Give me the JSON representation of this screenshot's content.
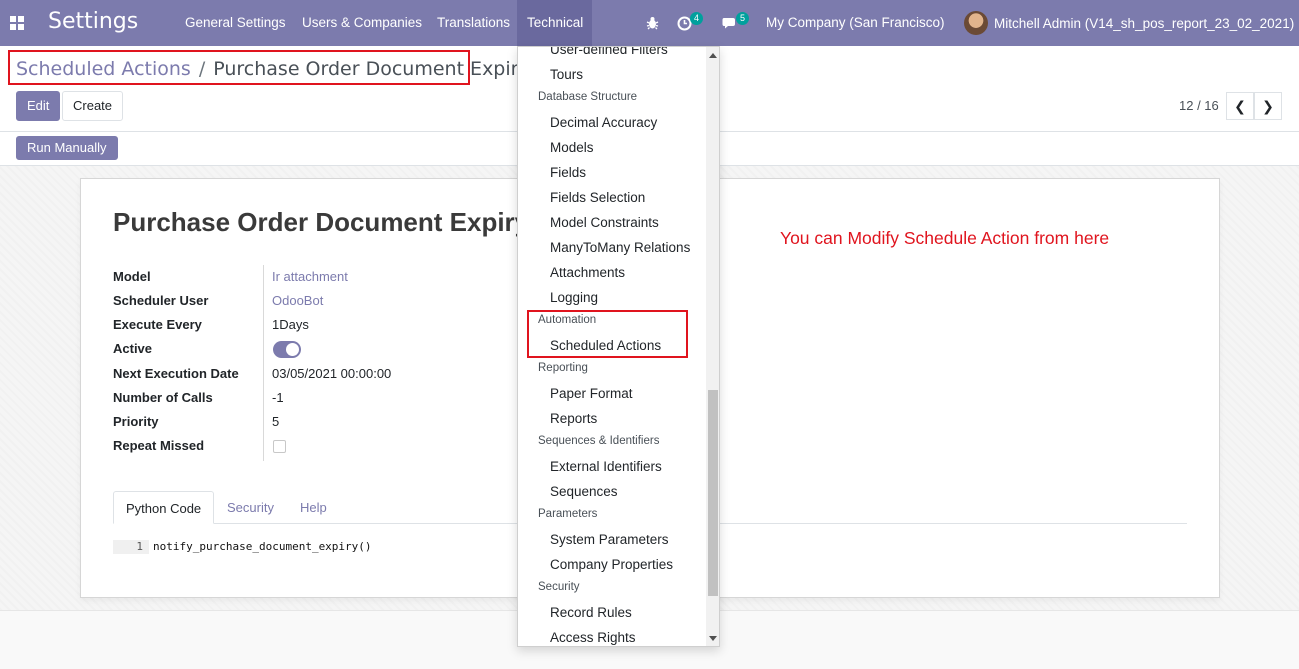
{
  "navbar": {
    "brand": "Settings",
    "menus": [
      "General Settings",
      "Users & Companies",
      "Translations",
      "Technical"
    ],
    "activity_count": "4",
    "messages_count": "5",
    "company": "My Company (San Francisco)",
    "user": "Mitchell Admin (V14_sh_pos_report_23_02_2021)"
  },
  "breadcrumb": {
    "parent": "Scheduled Actions",
    "separator": "/",
    "current": "Purchase Order Document Expiry"
  },
  "buttons": {
    "edit": "Edit",
    "create": "Create",
    "run_manually": "Run Manually"
  },
  "pager": {
    "value": "12 / 16",
    "prev": "❮",
    "next": "❯"
  },
  "record": {
    "title": "Purchase Order Document Expiry",
    "fields": {
      "model_label": "Model",
      "model_value": "Ir attachment",
      "scheduler_user_label": "Scheduler User",
      "scheduler_user_value": "OdooBot",
      "execute_every_label": "Execute Every",
      "execute_every_value": "1Days",
      "active_label": "Active",
      "active_value": true,
      "next_execution_label": "Next Execution Date",
      "next_execution_value": "03/05/2021 00:00:00",
      "number_of_calls_label": "Number of Calls",
      "number_of_calls_value": "-1",
      "priority_label": "Priority",
      "priority_value": "5",
      "repeat_missed_label": "Repeat Missed",
      "repeat_missed_value": false
    },
    "tabs": [
      "Python Code",
      "Security",
      "Help"
    ],
    "code": {
      "line_number": "1",
      "line": "notify_purchase_document_expiry()"
    }
  },
  "annotation": "You can Modify Schedule Action from here",
  "technical_menu": {
    "partial_top": "User-defined Filters",
    "tours": "Tours",
    "database_structure": {
      "header": "Database Structure",
      "items": [
        "Decimal Accuracy",
        "Models",
        "Fields",
        "Fields Selection",
        "Model Constraints",
        "ManyToMany Relations",
        "Attachments",
        "Logging"
      ]
    },
    "automation": {
      "header": "Automation",
      "items": [
        "Scheduled Actions"
      ]
    },
    "reporting": {
      "header": "Reporting",
      "items": [
        "Paper Format",
        "Reports"
      ]
    },
    "sequences": {
      "header": "Sequences & Identifiers",
      "items": [
        "External Identifiers",
        "Sequences"
      ]
    },
    "parameters": {
      "header": "Parameters",
      "items": [
        "System Parameters",
        "Company Properties"
      ]
    },
    "security": {
      "header": "Security",
      "items": [
        "Record Rules",
        "Access Rights"
      ]
    }
  },
  "colors": {
    "brand": "#7c7bad",
    "annotation": "#e0141e",
    "badge": "#00a09d"
  }
}
